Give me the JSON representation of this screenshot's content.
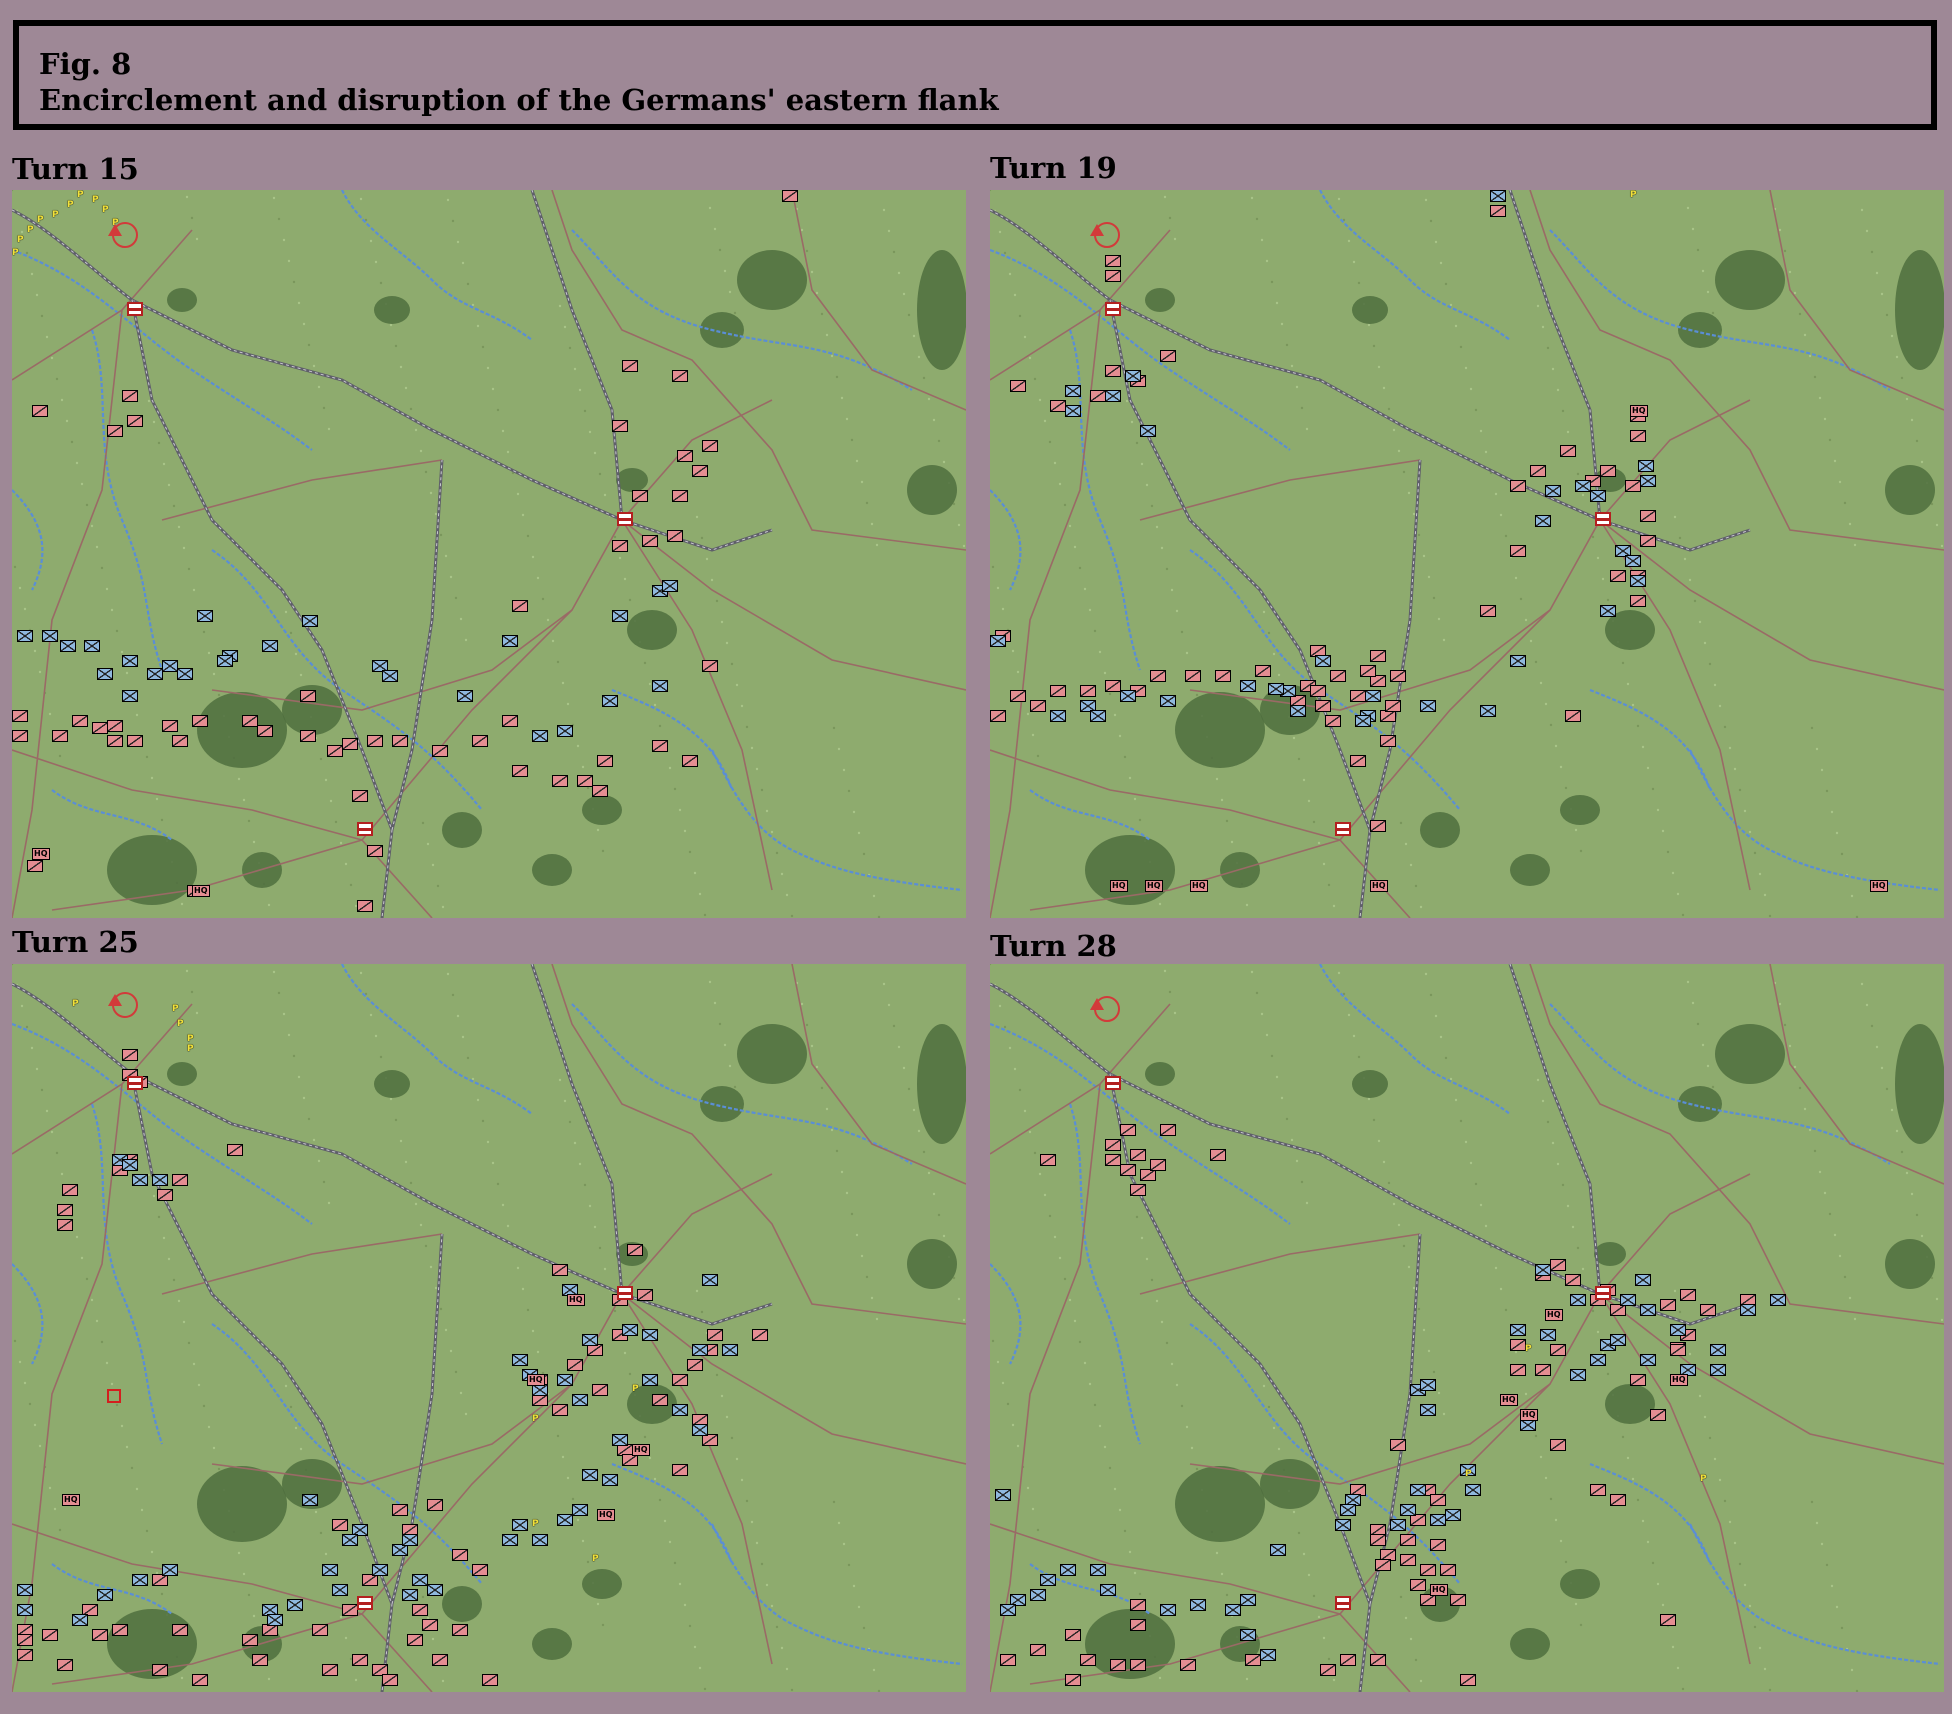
{
  "figure": {
    "number_label": "Fig. 8",
    "title": "Encirclement and disruption of the Germans' eastern flank"
  },
  "panels": [
    {
      "label": "Turn 15"
    },
    {
      "label": "Turn 19"
    },
    {
      "label": "Turn 25"
    },
    {
      "label": "Turn 28"
    }
  ],
  "colors": {
    "background": "#9e8896",
    "terrain": "#8eab6e",
    "forest": "#4f6e3e",
    "river": "#5a8ed6",
    "rail": "#5f5f6a",
    "road": "#9a6a66",
    "axis_unit": "#e48d92",
    "soviet_unit": "#8fb8de",
    "city_marker": "#b32020",
    "objective_marker": "#d23a3a",
    "supply_marker": "#f2e23a"
  },
  "unit_label": "HQ",
  "supply_label": "P"
}
